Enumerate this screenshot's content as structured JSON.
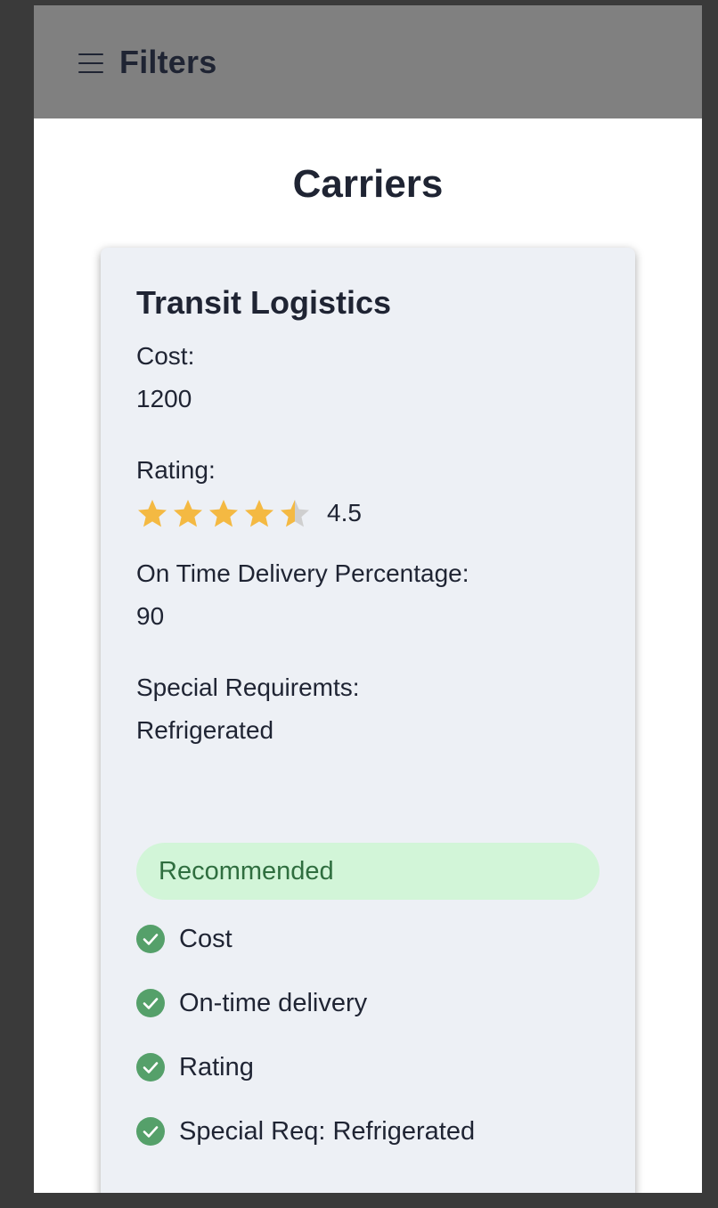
{
  "header": {
    "menu_icon": "hamburger-menu-icon",
    "title": "Filters"
  },
  "page": {
    "title": "Carriers"
  },
  "carrier": {
    "name": "Transit Logistics",
    "cost_label": "Cost:",
    "cost_value": "1200",
    "rating_label": "Rating:",
    "rating_value": "4.5",
    "rating_stars_filled_fraction": 0.9,
    "on_time_label": "On Time Delivery Percentage:",
    "on_time_value": "90",
    "special_label": "Special Requiremts:",
    "special_value": "Refrigerated"
  },
  "recommendation": {
    "badge": "Recommended",
    "reasons": [
      {
        "label": "Cost",
        "icon": "check-circle-icon"
      },
      {
        "label": "On-time delivery",
        "icon": "check-circle-icon"
      },
      {
        "label": "Rating",
        "icon": "check-circle-icon"
      },
      {
        "label": "Special Req: Refrigerated",
        "icon": "check-circle-icon"
      }
    ]
  },
  "colors": {
    "header_bg": "#808080",
    "card_bg": "#edf0f5",
    "star_filled": "#f4b942",
    "star_empty": "#cfcfcf",
    "badge_bg": "#d2f5d8",
    "badge_text": "#2f6e3f",
    "check": "#55a06a"
  }
}
